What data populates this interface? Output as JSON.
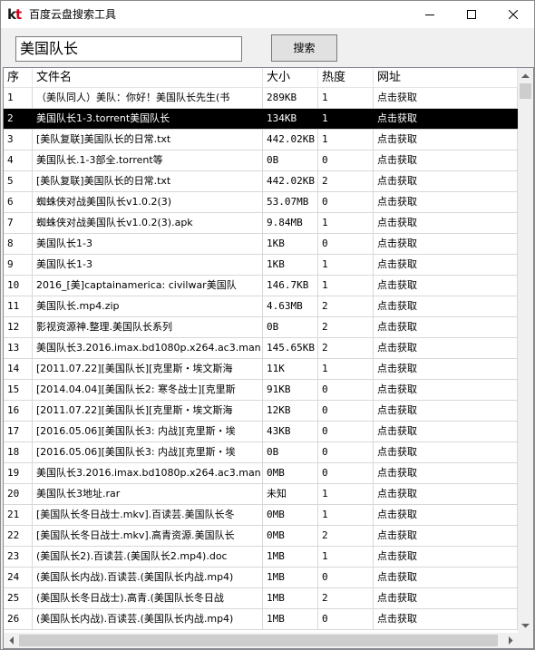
{
  "window": {
    "logo_k": "k",
    "logo_t": "t",
    "title": "百度云盘搜索工具"
  },
  "search": {
    "value": "美国队长",
    "button_label": "搜索"
  },
  "table": {
    "columns": [
      "序",
      "文件名",
      "大小",
      "热度",
      "网址"
    ],
    "selected_index": 1,
    "rows": [
      {
        "idx": "1",
        "name": "（美队同人）美队：你好！美国队长先生(书",
        "size": "289KB",
        "heat": "1",
        "url": "点击获取"
      },
      {
        "idx": "2",
        "name": "美国队长1-3.torrent美国队长",
        "size": "134KB",
        "heat": "1",
        "url": "点击获取"
      },
      {
        "idx": "3",
        "name": "[美队复联]美国队长的日常.txt",
        "size": "442.02KB",
        "heat": "1",
        "url": "点击获取"
      },
      {
        "idx": "4",
        "name": "美国队长.1-3部全.torrent等",
        "size": "0B",
        "heat": "0",
        "url": "点击获取"
      },
      {
        "idx": "5",
        "name": "[美队复联]美国队长的日常.txt",
        "size": "442.02KB",
        "heat": "2",
        "url": "点击获取"
      },
      {
        "idx": "6",
        "name": "蜘蛛侠对战美国队长v1.0.2(3)",
        "size": "53.07MB",
        "heat": "0",
        "url": "点击获取"
      },
      {
        "idx": "7",
        "name": "蜘蛛侠对战美国队长v1.0.2(3).apk",
        "size": "9.84MB",
        "heat": "1",
        "url": "点击获取"
      },
      {
        "idx": "8",
        "name": "美国队长1-3",
        "size": "1KB",
        "heat": "0",
        "url": "点击获取"
      },
      {
        "idx": "9",
        "name": "美国队长1-3",
        "size": "1KB",
        "heat": "1",
        "url": "点击获取"
      },
      {
        "idx": "10",
        "name": "2016_[美]captainamerica: civilwar美国队",
        "size": "146.7KB",
        "heat": "1",
        "url": "点击获取"
      },
      {
        "idx": "11",
        "name": "美国队长.mp4.zip",
        "size": "4.63MB",
        "heat": "2",
        "url": "点击获取"
      },
      {
        "idx": "12",
        "name": "影视资源神.整理.美国队长系列",
        "size": "0B",
        "heat": "2",
        "url": "点击获取"
      },
      {
        "idx": "13",
        "name": "美国队长3.2016.imax.bd1080p.x264.ac3.man",
        "size": "145.65KB",
        "heat": "2",
        "url": "点击获取"
      },
      {
        "idx": "14",
        "name": "[2011.07.22][美国队长][克里斯・埃文斯海",
        "size": "11K",
        "heat": "1",
        "url": "点击获取"
      },
      {
        "idx": "15",
        "name": "[2014.04.04][美国队长2: 寒冬战士][克里斯",
        "size": "91KB",
        "heat": "0",
        "url": "点击获取"
      },
      {
        "idx": "16",
        "name": "[2011.07.22][美国队长][克里斯・埃文斯海",
        "size": "12KB",
        "heat": "0",
        "url": "点击获取"
      },
      {
        "idx": "17",
        "name": "[2016.05.06][美国队长3: 内战][克里斯・埃",
        "size": "43KB",
        "heat": "0",
        "url": "点击获取"
      },
      {
        "idx": "18",
        "name": "[2016.05.06][美国队长3: 内战][克里斯・埃",
        "size": "0B",
        "heat": "0",
        "url": "点击获取"
      },
      {
        "idx": "19",
        "name": "美国队长3.2016.imax.bd1080p.x264.ac3.man",
        "size": "0MB",
        "heat": "0",
        "url": "点击获取"
      },
      {
        "idx": "20",
        "name": "美国队长3地址.rar",
        "size": "未知",
        "heat": "1",
        "url": "点击获取"
      },
      {
        "idx": "21",
        "name": "[美国队长冬日战士.mkv].百读芸.美国队长冬",
        "size": "0MB",
        "heat": "1",
        "url": "点击获取"
      },
      {
        "idx": "22",
        "name": "[美国队长冬日战士.mkv].高青资源.美国队长",
        "size": "0MB",
        "heat": "2",
        "url": "点击获取"
      },
      {
        "idx": "23",
        "name": "(美国队长2).百读芸.(美国队长2.mp4).doc",
        "size": "1MB",
        "heat": "1",
        "url": "点击获取"
      },
      {
        "idx": "24",
        "name": "(美国队长内战).百读芸.(美国队长内战.mp4)",
        "size": "1MB",
        "heat": "0",
        "url": "点击获取"
      },
      {
        "idx": "25",
        "name": "(美国队长冬日战士).高青.(美国队长冬日战",
        "size": "1MB",
        "heat": "2",
        "url": "点击获取"
      },
      {
        "idx": "26",
        "name": "(美国队长内战).百读芸.(美国队长内战.mp4)",
        "size": "1MB",
        "heat": "0",
        "url": "点击获取"
      }
    ]
  }
}
